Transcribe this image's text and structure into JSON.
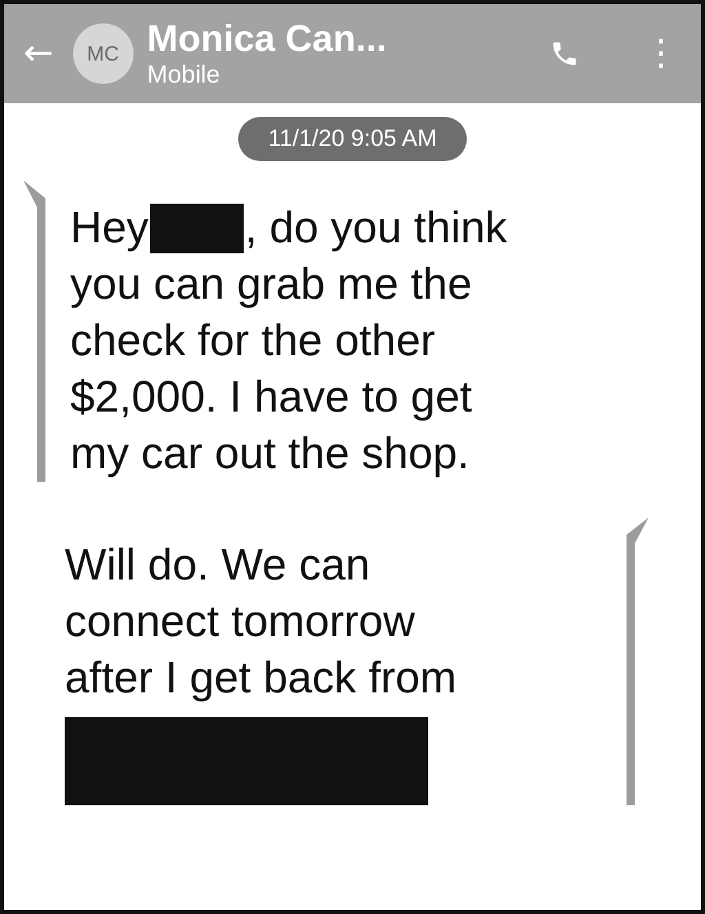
{
  "header": {
    "back": "←",
    "avatar": "MC",
    "name": "Monica Can...",
    "subtitle": "Mobile",
    "menu": "⋮"
  },
  "timestamp": "11/1/20 9:05 AM",
  "messages": [
    {
      "kind": "incoming",
      "lines": [
        [
          {
            "kind": "text",
            "text": "Hey"
          },
          {
            "kind": "redacted"
          },
          {
            "kind": "text",
            "text": ", do you think"
          }
        ],
        [
          {
            "kind": "text",
            "text": "you can grab me the"
          }
        ],
        [
          {
            "kind": "text",
            "text": "check for the other"
          }
        ],
        [
          {
            "kind": "text",
            "text": "$2,000. I have to get"
          }
        ],
        [
          {
            "kind": "text",
            "text": "my car out the shop."
          }
        ]
      ]
    },
    {
      "kind": "outgoing",
      "lines": [
        [
          {
            "kind": "text",
            "text": "Will do. We can"
          }
        ],
        [
          {
            "kind": "text",
            "text": "connect tomorrow"
          }
        ],
        [
          {
            "kind": "text",
            "text": "after I get back from"
          }
        ],
        [
          {
            "kind": "redacted_block"
          }
        ]
      ]
    }
  ]
}
